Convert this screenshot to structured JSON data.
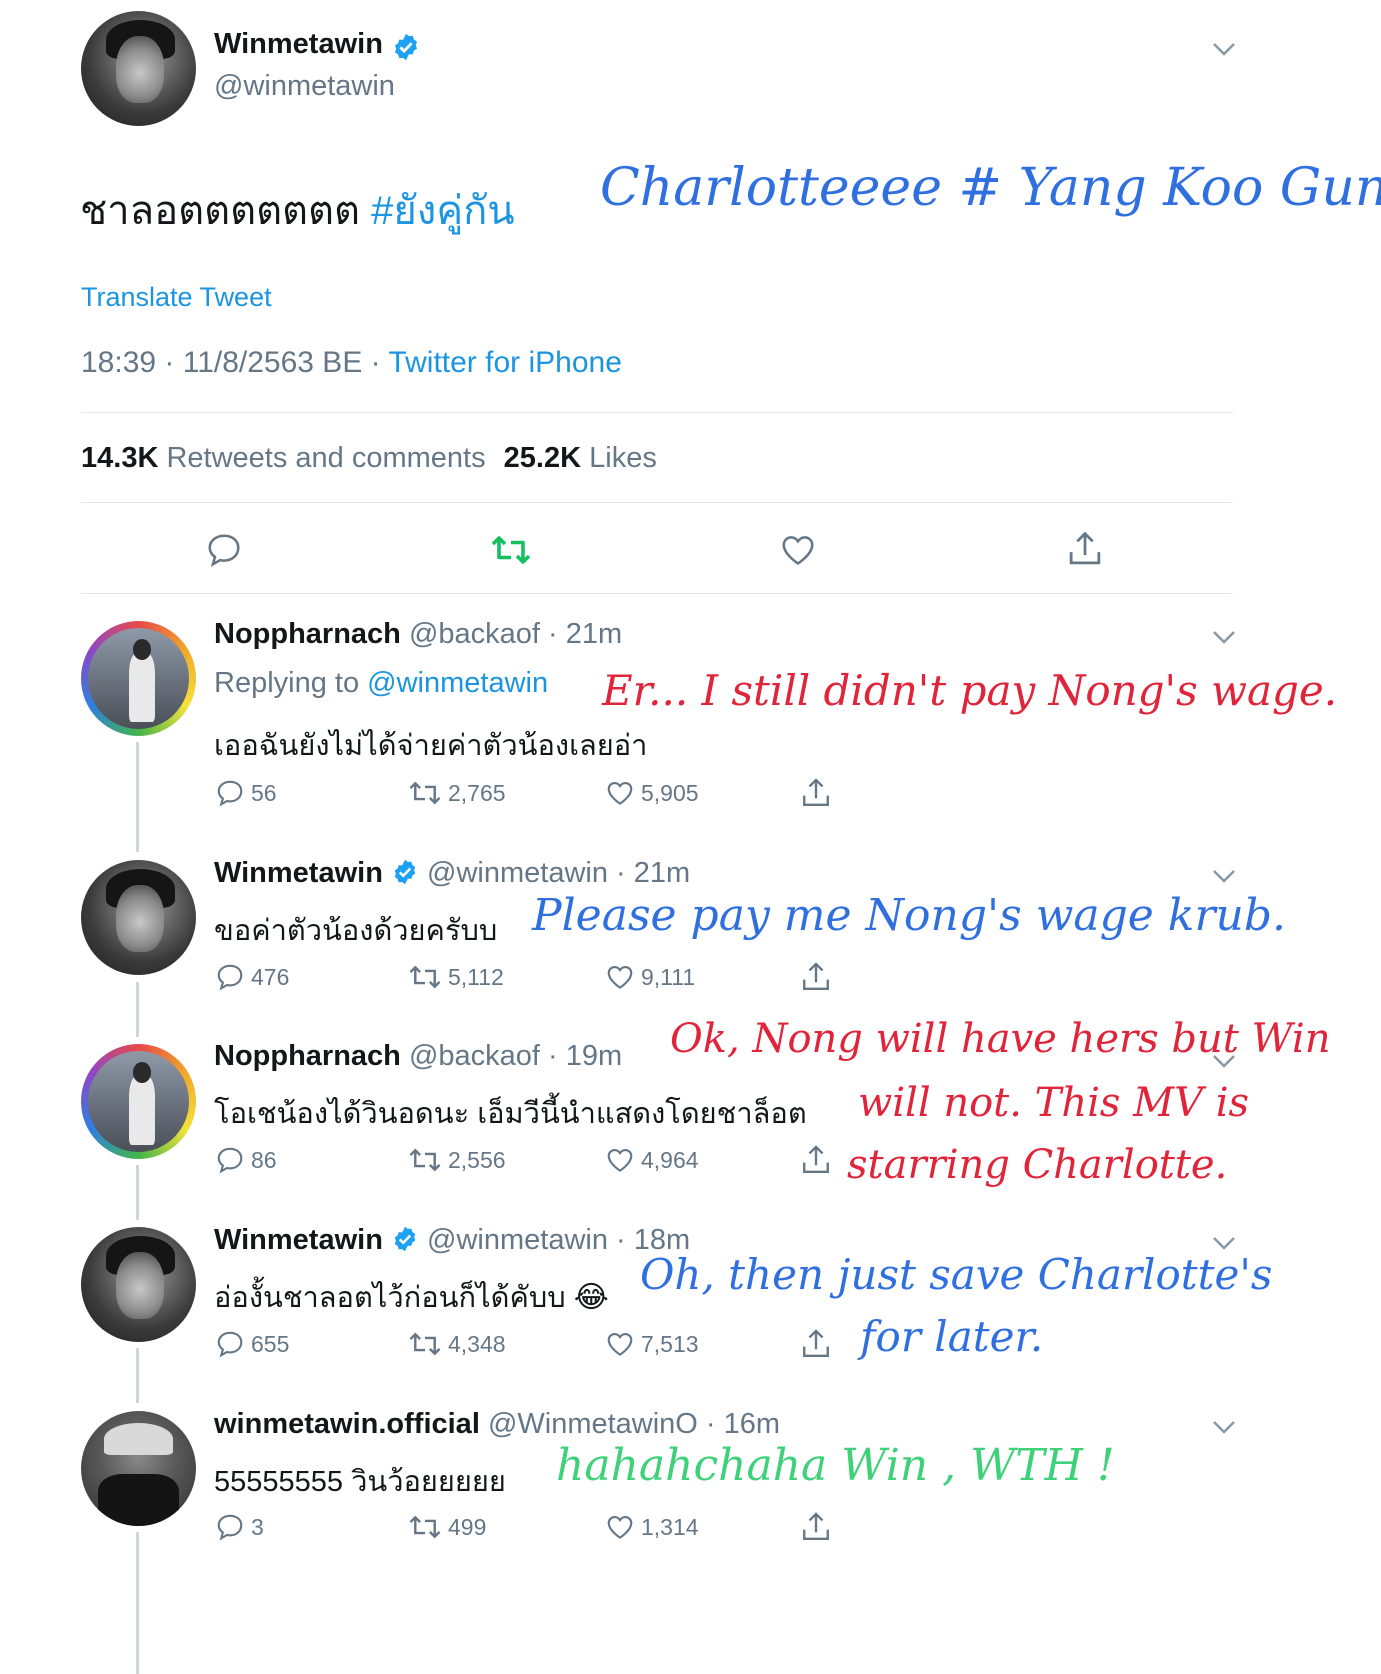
{
  "main_tweet": {
    "name": "Winmetawin",
    "handle": "@winmetawin",
    "text": "ชาลอตตตตตตต",
    "hashtag": "#ยังคู่กัน",
    "translate": "Translate Tweet",
    "time_date": "18:39 · 11/8/2563 BE · ",
    "source": "Twitter for iPhone",
    "retweets_count": "14.3K",
    "retweets_label": "Retweets and comments",
    "likes_count": "25.2K",
    "likes_label": "Likes"
  },
  "replies": [
    {
      "name": "Noppharnach",
      "handle": "@backaof",
      "time": " · 21m",
      "replying_prefix": "Replying to ",
      "replying_to": "@winmetawin",
      "text": "เออฉันยังไม่ได้จ่ายค่าตัวน้องเลยอ่า",
      "replies": "56",
      "retweets": "2,765",
      "likes": "5,905"
    },
    {
      "name": "Winmetawin",
      "handle": "@winmetawin",
      "time": " · 21m",
      "text": "ขอค่าตัวน้องด้วยครับบ",
      "replies": "476",
      "retweets": "5,112",
      "likes": "9,111"
    },
    {
      "name": "Noppharnach",
      "handle": "@backaof",
      "time": " · 19m",
      "text": "โอเชน้องได้วินอดนะ เอ็มวีนี้นำแสดงโดยชาล็อต",
      "replies": "86",
      "retweets": "2,556",
      "likes": "4,964"
    },
    {
      "name": "Winmetawin",
      "handle": "@winmetawin",
      "time": " · 18m",
      "text": "อ่องั้นชาลอตไว้ก่อนก็ได้คับบ",
      "emoji": "😂",
      "replies": "655",
      "retweets": "4,348",
      "likes": "7,513"
    },
    {
      "name": "winmetawin.official",
      "handle": "@WinmetawinO",
      "time": " · 16m",
      "text": "55555555 วินว้อยยยยย",
      "replies": "3",
      "retweets": "499",
      "likes": "1,314"
    }
  ],
  "annotations": {
    "a1": "Charlotteeee  # Yang Koo Gun",
    "a2": "Er... I still didn't pay Nong's wage.",
    "a3": "Please pay me Nong's wage krub.",
    "a4_l1": "Ok, Nong will have hers but Win",
    "a4_l2": "will not.  This MV is",
    "a4_l3": "starring  Charlotte.",
    "a5_l1": "Oh, then just save Charlotte's",
    "a5_l2": "for later.",
    "a6": "hahahchaha  Win , WTH !"
  },
  "colors": {
    "link_blue": "#1b95e0",
    "retweet_green": "#17bf63",
    "annotation_blue": "#2f6fe0",
    "annotation_red": "#e0243a",
    "annotation_green": "#3fd17a"
  }
}
